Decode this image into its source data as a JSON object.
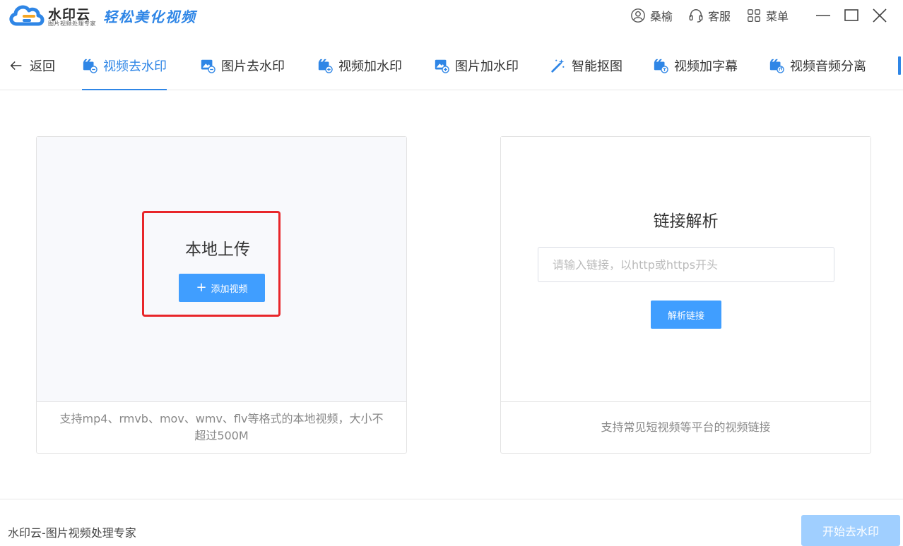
{
  "app": {
    "brand": "水印云",
    "brand_sub": "图片视频处理专家",
    "slogan": "轻松美化视频"
  },
  "titlebar": {
    "user_name": "桑榆",
    "service_label": "客服",
    "menu_label": "菜单",
    "icons": [
      "user-icon",
      "headset-icon",
      "grid-icon",
      "minimize-icon",
      "maximize-icon",
      "close-icon"
    ]
  },
  "tabs": {
    "back_label": "返回",
    "items": [
      {
        "label": "视频去水印",
        "icon": "video-remove-icon",
        "active": true
      },
      {
        "label": "图片去水印",
        "icon": "image-remove-icon",
        "active": false
      },
      {
        "label": "视频加水印",
        "icon": "video-add-icon",
        "active": false
      },
      {
        "label": "图片加水印",
        "icon": "image-add-icon",
        "active": false
      },
      {
        "label": "智能抠图",
        "icon": "magic-wand-icon",
        "active": false
      },
      {
        "label": "视频加字幕",
        "icon": "video-subtitle-icon",
        "active": false
      },
      {
        "label": "视频音频分离",
        "icon": "video-audio-icon",
        "active": false
      }
    ]
  },
  "upload": {
    "title": "本地上传",
    "button_label": "添加视频",
    "hint": "支持mp4、rmvb、mov、wmv、flv等格式的本地视频，大小不超过500M"
  },
  "link": {
    "title": "链接解析",
    "placeholder": "请输入链接，以http或https开头",
    "value": "",
    "button_label": "解析链接",
    "hint": "支持常见短视频等平台的视频链接"
  },
  "footer": {
    "text": "水印云-图片视频处理专家",
    "start_button": "开始去水印"
  },
  "colors": {
    "accent": "#2f86e6",
    "primary_button": "#409eff",
    "disabled_button": "#a0cfff",
    "highlight_box": "#e8262a"
  }
}
